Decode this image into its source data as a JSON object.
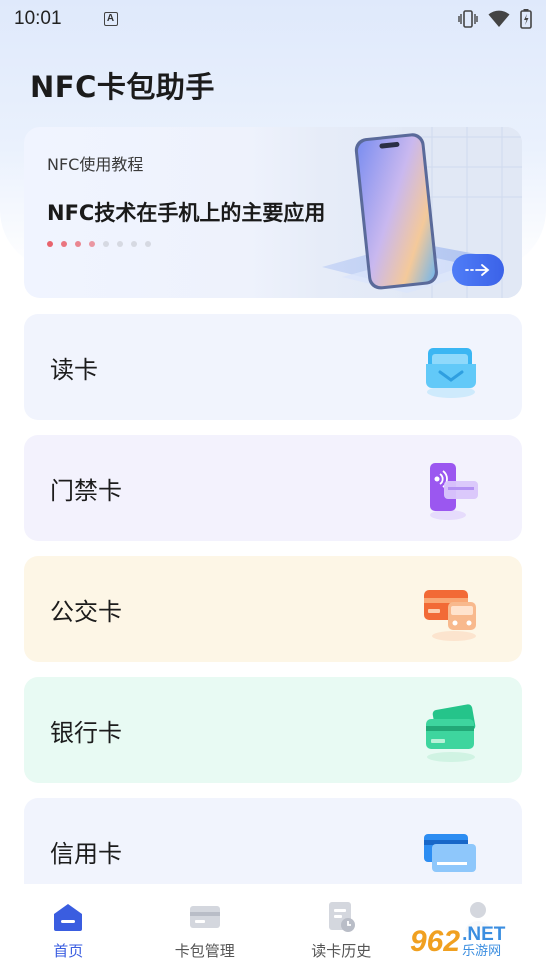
{
  "status_bar": {
    "time": "10:01",
    "notification_glyph": "A",
    "icons": [
      "vibrate-icon",
      "wifi-icon",
      "battery-icon"
    ]
  },
  "app": {
    "title": "NFC卡包助手"
  },
  "banner": {
    "subtitle": "NFC使用教程",
    "title": "NFC技术在手机上的主要应用",
    "page_count": 8,
    "active_dots": 4,
    "accent_color": "#e8636d",
    "arrow_button": "arrow-right-icon"
  },
  "cards": [
    {
      "label": "读卡",
      "icon": "card-reader-icon",
      "bg": "#f1f4fd"
    },
    {
      "label": "门禁卡",
      "icon": "access-card-icon",
      "bg": "#f3f2fd"
    },
    {
      "label": "公交卡",
      "icon": "bus-card-icon",
      "bg": "#fdf6e6"
    },
    {
      "label": "银行卡",
      "icon": "bank-card-icon",
      "bg": "#e8faf3"
    },
    {
      "label": "信用卡",
      "icon": "credit-card-icon",
      "bg": "#f1f4fd"
    }
  ],
  "tabbar": {
    "active_color": "#3a5de0",
    "items": [
      {
        "label": "首页",
        "icon": "home-icon",
        "active": true
      },
      {
        "label": "卡包管理",
        "icon": "wallet-icon",
        "active": false
      },
      {
        "label": "读卡历史",
        "icon": "history-icon",
        "active": false
      },
      {
        "label": "",
        "icon": "profile-icon",
        "active": false
      }
    ]
  },
  "watermark": {
    "number": "962",
    "net": ".NET",
    "site": "乐游网"
  }
}
